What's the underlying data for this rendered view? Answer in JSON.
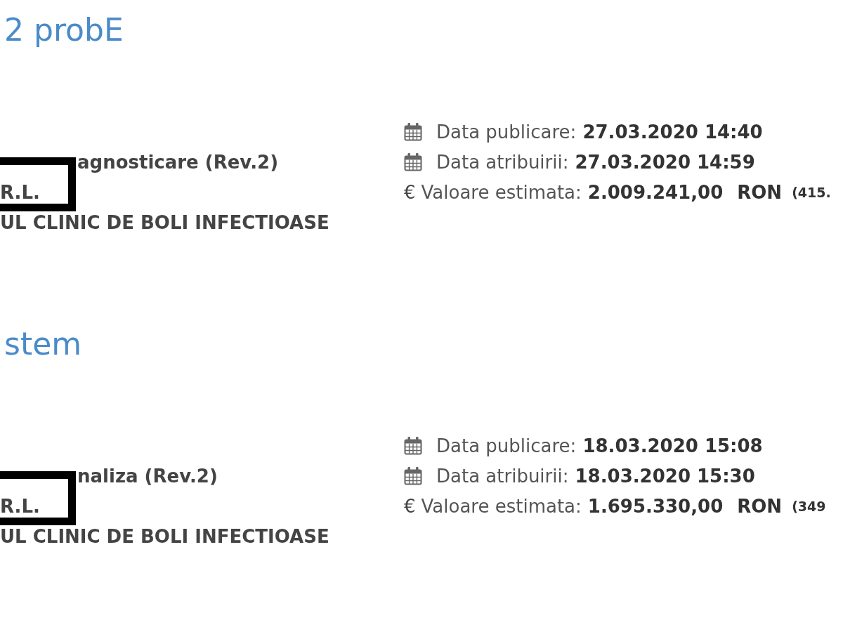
{
  "listings": [
    {
      "title": "2 probE",
      "lot": "agnosticare (Rev.2)",
      "supplier": {
        "name": "R.L.",
        "framed": true
      },
      "authority": "UL CLINIC DE BOLI INFECTIOASE",
      "dates": [
        {
          "label": "Data publicare:",
          "value": "27.03.2020 14:40"
        },
        {
          "label": "Data atribuirii:",
          "value": "27.03.2020 14:59"
        }
      ],
      "estimate": {
        "symbol": "€",
        "label": "Valoare estimata:",
        "value": "2.009.241,00",
        "currency": "RON",
        "converted": "(415."
      }
    },
    {
      "title": "stem",
      "lot": "naliza (Rev.2)",
      "supplier": {
        "name": "R.L.",
        "framed": true
      },
      "authority": "UL CLINIC DE BOLI INFECTIOASE",
      "dates": [
        {
          "label": "Data publicare:",
          "value": "18.03.2020 15:08"
        },
        {
          "label": "Data atribuirii:",
          "value": "18.03.2020 15:30"
        }
      ],
      "estimate": {
        "symbol": "€",
        "label": "Valoare estimata:",
        "value": "1.695.330,00",
        "currency": "RON",
        "converted": "(349"
      }
    }
  ]
}
